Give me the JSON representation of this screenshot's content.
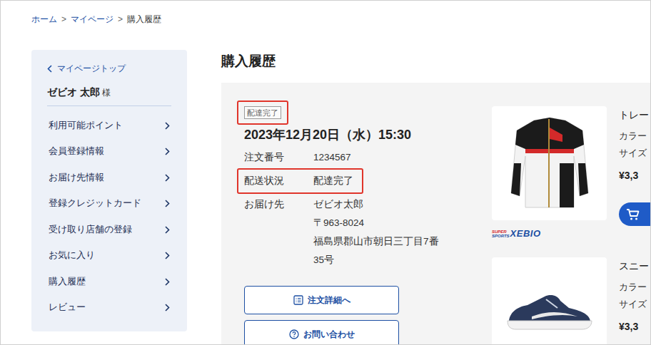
{
  "breadcrumb": {
    "separator": ">",
    "items": [
      {
        "label": "ホーム",
        "link": true
      },
      {
        "label": "マイページ",
        "link": true
      },
      {
        "label": "購入履歴",
        "link": false
      }
    ]
  },
  "sidebar": {
    "back_label": "マイページトップ",
    "user_name": "ゼビオ 太郎",
    "honorific": "様",
    "items": [
      "利用可能ポイント",
      "会員登録情報",
      "お届け先情報",
      "登録クレジットカード",
      "受け取り店舗の登録",
      "お気に入り",
      "購入履歴",
      "レビュー"
    ]
  },
  "page_title": "購入履歴",
  "order": {
    "status_badge": "配達完了",
    "badge_highlighted": true,
    "date": "2023年12月20日（水）15:30",
    "fields": [
      {
        "label": "注文番号",
        "lines": [
          "1234567"
        ],
        "highlighted": false
      },
      {
        "label": "配送状況",
        "lines": [
          "配達完了"
        ],
        "highlighted": true
      },
      {
        "label": "お届け先",
        "lines": [
          "ゼビオ太郎",
          "〒963-8024",
          "福島県郡山市朝日三丁目7番",
          "35号"
        ],
        "highlighted": false
      }
    ],
    "buttons": [
      {
        "label": "注文詳細へ",
        "kind": "detail"
      },
      {
        "label": "お問い合わせ",
        "kind": "inquiry"
      }
    ]
  },
  "products": [
    {
      "name": "トレー",
      "color_label": "カラー",
      "size_label": "サイズ",
      "price": "¥3,3",
      "cart_button": true,
      "shop_logo": {
        "line1": "SUPER",
        "line2": "SPORTS",
        "brand": "XEBIO"
      }
    },
    {
      "name": "スニー",
      "color_label": "カラー",
      "size_label": "サイズ",
      "price": "¥3,3",
      "cart_button": false,
      "shop_logo": null
    }
  ]
}
